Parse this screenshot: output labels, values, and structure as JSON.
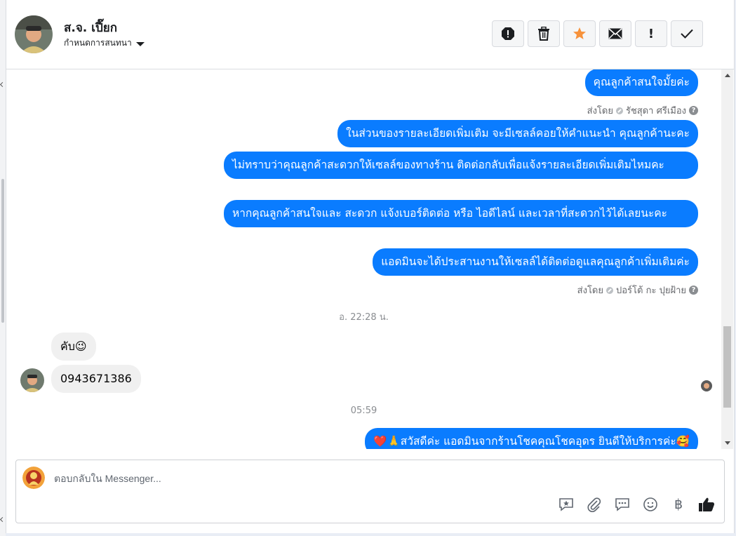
{
  "header": {
    "contact_name": "ส.จ. เปี๊ยก",
    "assign_label": "กำหนดการสนทนา",
    "toolbar_icons": [
      "spam-icon",
      "trash-icon",
      "star-icon",
      "mail-icon",
      "exclamation-icon",
      "check-icon"
    ]
  },
  "thread": {
    "messages_out_1": [
      "คุณลูกค้าสนใจมั้ยค่ะ"
    ],
    "sent_by_1": {
      "label": "ส่งโดย",
      "name": "รัชสุดา ศรีเมือง"
    },
    "messages_out_2": [
      "ในส่วนของรายละเอียดเพิ่มเติม จะมีเซลล์คอยให้คำแนะนำ คุณลูกค้านะคะ",
      "ไม่ทราบว่าคุณลูกค้าสะดวกให้เซลล์ของทางร้าน ติดต่อกลับเพื่อแจ้งรายละเอียดเพิ่มเติมไหมคะ",
      "หากคุณลูกค้าสนใจและ สะดวก แจ้งเบอร์ติดต่อ หรือ ไอดีไลน์ และเวลาที่สะดวกไว้ได้เลยนะคะ",
      "แอดมินจะได้ประสานงานให้เซลล์ได้ติดต่อดูแลคุณลูกค้าเพิ่มเติมค่ะ"
    ],
    "sent_by_2": {
      "label": "ส่งโดย",
      "name": "ปอร์โต้ กะ ปุยฝ้าย"
    },
    "time_1": "อ. 22:28 น.",
    "messages_in": [
      "คับ😉",
      "0943671386"
    ],
    "time_2": "05:59",
    "messages_out_3": [
      "❤️🙏สวัสดีค่ะ แอดมินจากร้านโชคคุณโชคอุดร ยินดีให้บริการค่ะ🥰"
    ]
  },
  "composer": {
    "placeholder": "ตอบกลับใน Messenger...",
    "tools": [
      "saved-reply-icon",
      "attachment-icon",
      "quick-reply-icon",
      "emoji-icon",
      "baht-icon",
      "like-icon"
    ],
    "baht_symbol": "฿"
  },
  "colors": {
    "bubble_out": "#0a7cff",
    "bubble_in": "#f0f0f0",
    "star": "#f7923b"
  }
}
